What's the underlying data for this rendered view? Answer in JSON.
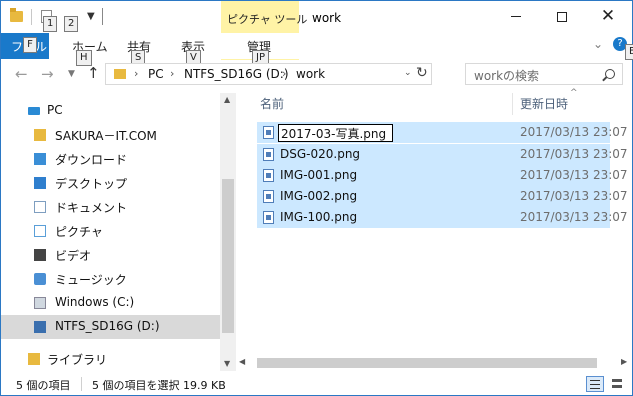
{
  "titlebar": {
    "contextual_tab_label": "ピクチャ ツール",
    "title": "work",
    "minimize_glyph": "—",
    "maximize_glyph": "☐",
    "close_glyph": "✕"
  },
  "ribbon": {
    "file": "ファイル",
    "file_visible": "フ",
    "file_visible_tail": "ル",
    "home": "ホーム",
    "share": "共有",
    "view": "表示",
    "manage": "管理",
    "help": "?"
  },
  "keytips": {
    "qa1": "1",
    "qa2": "2",
    "file": "F",
    "home": "H",
    "share": "S",
    "view": "V",
    "manage": "JP",
    "expand": "E"
  },
  "address": {
    "segments": [
      "PC",
      "NTFS_SD16G (D:)",
      "work"
    ],
    "search_placeholder": "workの検索"
  },
  "nav_pane": {
    "items": [
      {
        "label": "PC",
        "icon": "pc-icon"
      },
      {
        "label": "SAKURA－IT.COM",
        "icon": "folder-icon"
      },
      {
        "label": "ダウンロード",
        "icon": "download-icon"
      },
      {
        "label": "デスクトップ",
        "icon": "desktop-icon"
      },
      {
        "label": "ドキュメント",
        "icon": "document-icon"
      },
      {
        "label": "ピクチャ",
        "icon": "picture-icon"
      },
      {
        "label": "ビデオ",
        "icon": "video-icon"
      },
      {
        "label": "ミュージック",
        "icon": "music-icon"
      },
      {
        "label": "Windows (C:)",
        "icon": "windows-drive-icon"
      },
      {
        "label": "NTFS_SD16G (D:)",
        "icon": "usb-drive-icon",
        "selected": true
      },
      {
        "label": "ライブラリ",
        "icon": "library-icon"
      }
    ]
  },
  "file_list": {
    "col_name": "名前",
    "col_date": "更新日時",
    "sort_indicator": "^",
    "files": [
      {
        "name": "2017-03-写真.png",
        "date": "2017/03/13 23:07",
        "renaming": true
      },
      {
        "name": "DSG-020.png",
        "date": "2017/03/13 23:07"
      },
      {
        "name": "IMG-001.png",
        "date": "2017/03/13 23:07"
      },
      {
        "name": "IMG-002.png",
        "date": "2017/03/13 23:07"
      },
      {
        "name": "IMG-100.png",
        "date": "2017/03/13 23:07"
      }
    ]
  },
  "status_bar": {
    "item_count": "5 個の項目",
    "selection": "5 個の項目を選択  19.9 KB"
  }
}
